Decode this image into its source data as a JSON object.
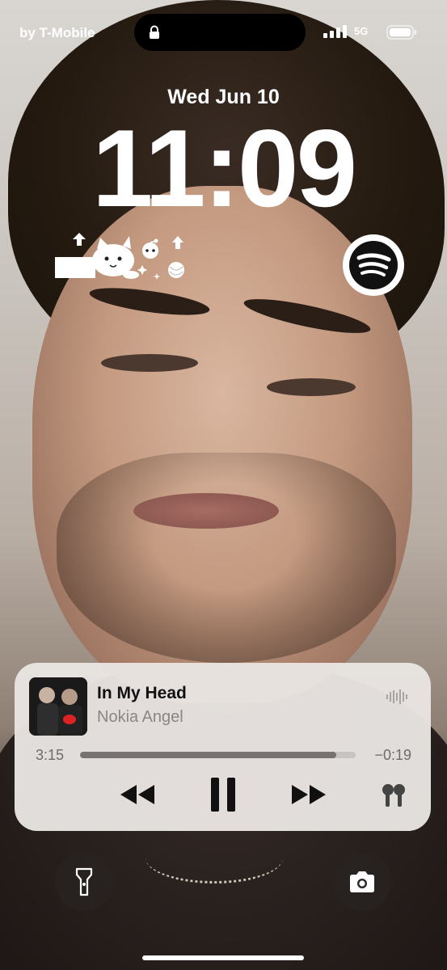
{
  "status_bar": {
    "carrier": "by T-Mobile",
    "network": "5G"
  },
  "lock_screen": {
    "date": "Wed Jun 10",
    "time": "11:09"
  },
  "widgets": {
    "left": "reddit-cat-widget",
    "right": "spotify-icon"
  },
  "now_playing": {
    "title": "In My Head",
    "artist": "Nokia Angel",
    "elapsed": "3:15",
    "remaining": "−0:19",
    "progress": 0.93,
    "controls": {
      "previous": "rewind-icon",
      "play_pause": "pause-icon",
      "next": "fast-forward-icon",
      "output": "airpods-icon"
    }
  },
  "quick_actions": {
    "left": "flashlight-icon",
    "right": "camera-icon"
  },
  "colors": {
    "card": "#e9e5e2",
    "accent": "#111111",
    "secondary_text": "#8a8684"
  }
}
